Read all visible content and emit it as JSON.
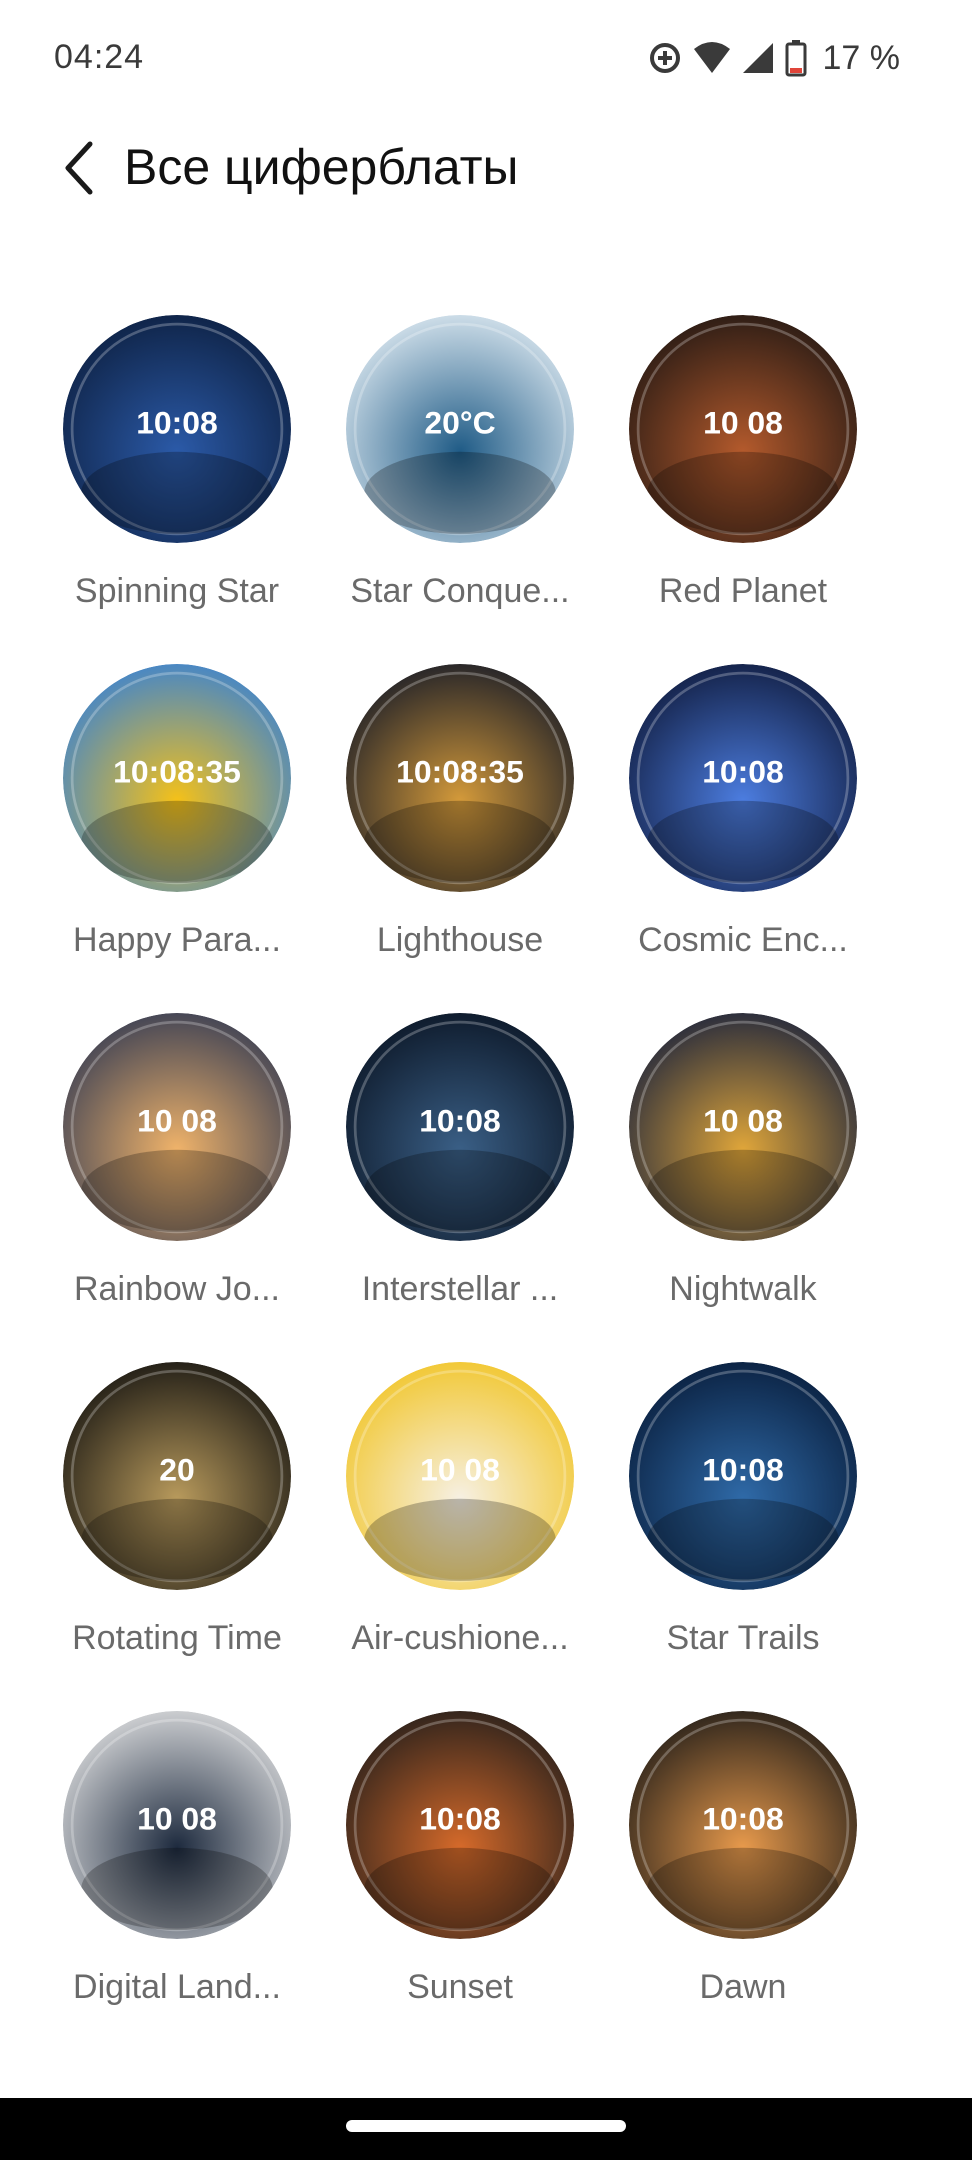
{
  "status": {
    "time": "04:24",
    "battery": "17 %"
  },
  "header": {
    "title": "Все циферблаты"
  },
  "faces": [
    {
      "label": "Spinning Star",
      "time": "10:08",
      "colors": [
        "#0b1c3a",
        "#2b5aa8"
      ]
    },
    {
      "label": "Star Conque...",
      "time": "20°C",
      "colors": [
        "#e9f2f8",
        "#1f5b86"
      ]
    },
    {
      "label": "Red Planet",
      "time": "10 08",
      "colors": [
        "#1a1412",
        "#b45a2c"
      ]
    },
    {
      "label": "Happy Para...",
      "time": "10:08:35",
      "colors": [
        "#2d7ee0",
        "#f5c118"
      ]
    },
    {
      "label": "Lighthouse",
      "time": "10:08:35",
      "colors": [
        "#0d1426",
        "#d49a3a"
      ]
    },
    {
      "label": "Cosmic Enc...",
      "time": "10:08",
      "colors": [
        "#0c1533",
        "#4c7de0"
      ]
    },
    {
      "label": "Rainbow Jo...",
      "time": "10 08",
      "colors": [
        "#2a3552",
        "#f0b36a"
      ]
    },
    {
      "label": "Interstellar ...",
      "time": "10:08",
      "colors": [
        "#08111f",
        "#3a5f86"
      ]
    },
    {
      "label": "Nightwalk",
      "time": "10 08",
      "colors": [
        "#0f1b3c",
        "#e0a63a"
      ]
    },
    {
      "label": "Rotating Time",
      "time": "20",
      "colors": [
        "#0d0d0d",
        "#b89a5c"
      ]
    },
    {
      "label": "Air-cushione...",
      "time": "10 08",
      "colors": [
        "#f1c21b",
        "#f6f0e3"
      ]
    },
    {
      "label": "Star Trails",
      "time": "10:08",
      "colors": [
        "#061834",
        "#2f6aa8"
      ]
    },
    {
      "label": "Digital Land...",
      "time": "10 08",
      "colors": [
        "#e8e8e8",
        "#1d2a3e"
      ]
    },
    {
      "label": "Sunset",
      "time": "10:08",
      "colors": [
        "#1a1a1a",
        "#d66a2a"
      ]
    },
    {
      "label": "Dawn",
      "time": "10:08",
      "colors": [
        "#151515",
        "#e89a4c"
      ]
    }
  ]
}
